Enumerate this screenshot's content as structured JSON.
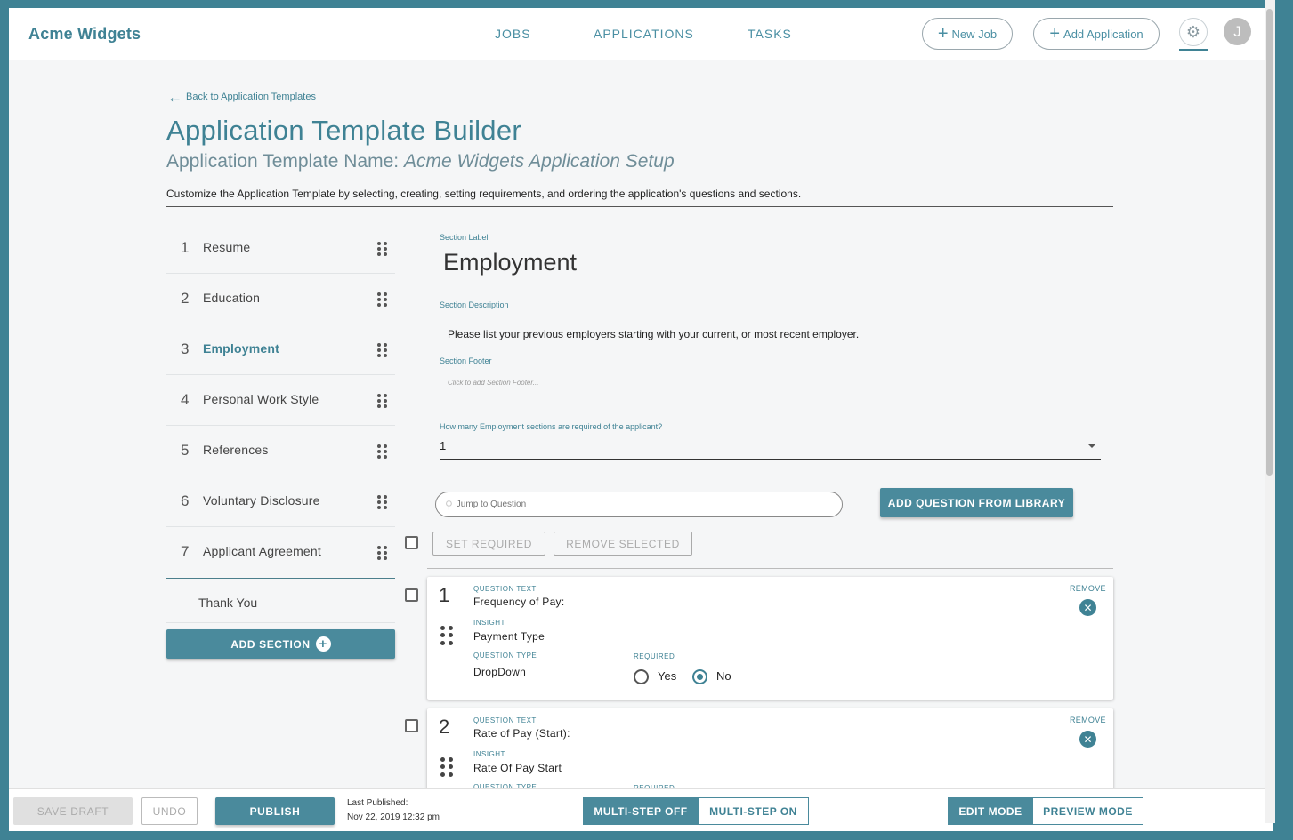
{
  "app": {
    "brand": "Acme Widgets",
    "accent_color": "#3f8294",
    "nav": [
      {
        "label": "JOBS"
      },
      {
        "label": "APPLICATIONS"
      },
      {
        "label": "TASKS"
      }
    ],
    "new_job_label": "New Job",
    "add_application_label": "Add Application",
    "avatar_initial": "J"
  },
  "header": {
    "back_label": "Back to Application Templates",
    "title": "Application Template Builder",
    "subtitle_prefix": "Application Template Name:",
    "template_name": "Acme Widgets Application Setup",
    "description": "Customize the Application Template by selecting, creating, setting requirements, and ordering the application's questions and sections."
  },
  "sections": [
    {
      "num": "1",
      "label": "Resume"
    },
    {
      "num": "2",
      "label": "Education"
    },
    {
      "num": "3",
      "label": "Employment",
      "active": true
    },
    {
      "num": "4",
      "label": "Personal Work Style"
    },
    {
      "num": "5",
      "label": "References"
    },
    {
      "num": "6",
      "label": "Voluntary Disclosure"
    },
    {
      "num": "7",
      "label": "Applicant Agreement"
    }
  ],
  "thank_you_label": "Thank You",
  "add_section_label": "ADD SECTION",
  "editor": {
    "section_label_caption": "Section Label",
    "section_label_value": "Employment",
    "section_description_caption": "Section Description",
    "section_description_value": "Please list your previous employers starting with your current, or most recent employer.",
    "section_footer_caption": "Section Footer",
    "section_footer_placeholder": "Click to add Section Footer...",
    "required_count_caption": "How many Employment sections are required of the applicant?",
    "required_count_value": "1",
    "jump_placeholder": "Jump to Question",
    "add_question_label": "ADD QUESTION FROM LIBRARY",
    "set_required_label": "SET REQUIRED",
    "remove_selected_label": "REMOVE SELECTED"
  },
  "questions": [
    {
      "num": "1",
      "text_caption": "QUESTION TEXT",
      "text": "Frequency of Pay:",
      "insight_caption": "INSIGHT",
      "insight": "Payment Type",
      "type_caption": "QUESTION TYPE",
      "type": "DropDown",
      "required_caption": "REQUIRED",
      "yes_label": "Yes",
      "no_label": "No",
      "required": "No",
      "remove_label": "REMOVE"
    },
    {
      "num": "2",
      "text_caption": "QUESTION TEXT",
      "text": "Rate of Pay (Start):",
      "insight_caption": "INSIGHT",
      "insight": "Rate Of Pay Start",
      "type_caption": "QUESTION TYPE",
      "required_caption": "REQUIRED",
      "remove_label": "REMOVE"
    }
  ],
  "footer": {
    "save_draft_label": "SAVE DRAFT",
    "undo_label": "UNDO",
    "publish_label": "PUBLISH",
    "last_published_caption": "Last Published:",
    "last_published_value": "Nov 22, 2019 12:32 pm",
    "multistep_off_label": "MULTI-STEP OFF",
    "multistep_on_label": "MULTI-STEP ON",
    "edit_mode_label": "EDIT MODE",
    "preview_mode_label": "PREVIEW MODE"
  }
}
